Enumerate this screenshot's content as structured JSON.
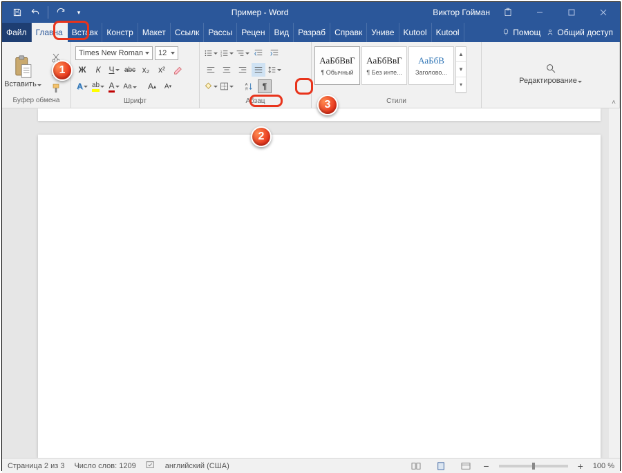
{
  "title": "Пример  -  Word",
  "user": "Виктор Гойман",
  "qat": {
    "save": "save",
    "undo": "undo",
    "redo": "redo"
  },
  "tabs": {
    "file": "Файл",
    "items": [
      "Главна",
      "Вставк",
      "Констр",
      "Макет",
      "Ссылк",
      "Рассы",
      "Рецен",
      "Вид",
      "Разраб",
      "Справк",
      "Униве",
      "Kutool",
      "Kutool"
    ],
    "help": "Помощ",
    "share": "Общий доступ"
  },
  "groups": {
    "clipboard": {
      "paste": "Вставить",
      "label": "Буфер обмена"
    },
    "font": {
      "name": "Times New Roman",
      "size": "12",
      "bold": "Ж",
      "italic": "К",
      "underline": "Ч",
      "strike": "abc",
      "sub": "x₂",
      "sup": "x²",
      "label": "Шрифт"
    },
    "para": {
      "label": "Абзац"
    },
    "styles": {
      "label": "Стили",
      "list": [
        {
          "sample": "АаБбВвГ",
          "name": "¶ Обычный"
        },
        {
          "sample": "АаБбВвГ",
          "name": "¶ Без инте..."
        },
        {
          "sample": "АаБбВ",
          "name": "Заголово..."
        }
      ]
    },
    "editing": {
      "label": "Редактирование"
    }
  },
  "status": {
    "page": "Страница 2 из 3",
    "words": "Число слов: 1209",
    "lang": "английский (США)",
    "zoom": "100 %"
  },
  "annotations": {
    "a1": "1",
    "a2": "2",
    "a3": "3"
  }
}
